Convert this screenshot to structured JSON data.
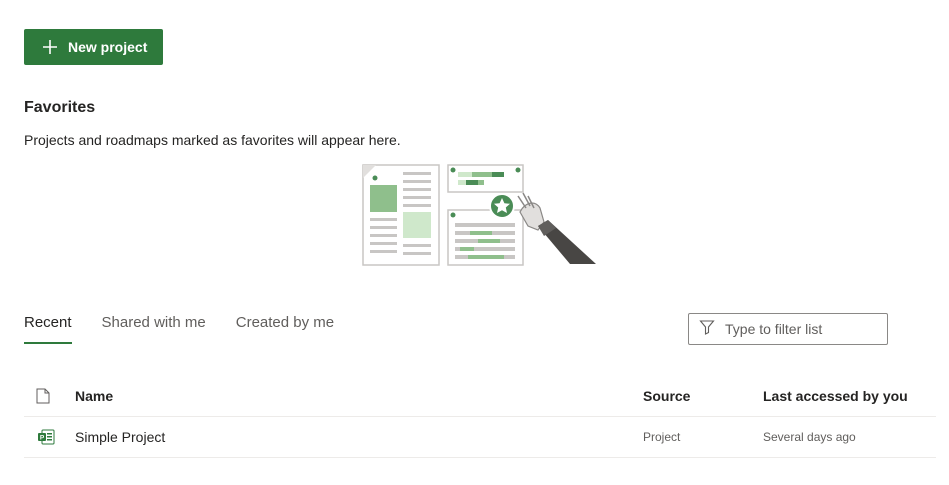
{
  "toolbar": {
    "new_project_label": "New project"
  },
  "favorites": {
    "title": "Favorites",
    "description": "Projects and roadmaps marked as favorites will appear here."
  },
  "tabs": [
    {
      "label": "Recent",
      "active": true
    },
    {
      "label": "Shared with me",
      "active": false
    },
    {
      "label": "Created by me",
      "active": false
    }
  ],
  "filter": {
    "placeholder": "Type to filter list"
  },
  "table": {
    "columns": {
      "name": "Name",
      "source": "Source",
      "last_accessed": "Last accessed by you"
    },
    "rows": [
      {
        "name": "Simple Project",
        "source": "Project",
        "last_accessed": "Several days ago",
        "icon": "project-file-icon"
      }
    ]
  },
  "colors": {
    "accent": "#2e7a3c",
    "text": "#252423",
    "muted": "#605e5c",
    "border": "#8a8886"
  }
}
